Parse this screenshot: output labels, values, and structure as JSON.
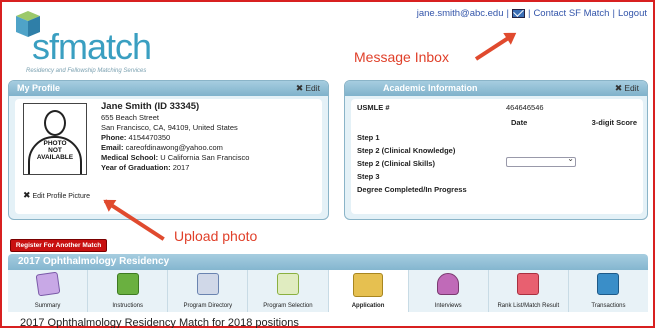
{
  "brand": {
    "logo_text": "sfmatch",
    "tagline": "Residency and Fellowship Matching Services"
  },
  "toplinks": {
    "email": "jane.smith@abc.edu",
    "contact": "Contact SF Match",
    "logout": "Logout"
  },
  "annotations": {
    "message_inbox": "Message Inbox",
    "upload_photo": "Upload photo"
  },
  "profile": {
    "title": "My Profile",
    "edit_label": "Edit",
    "photo_text": "PHOTO\nNOT\nAVAILABLE",
    "name": "Jane Smith (ID 33345)",
    "street": "655 Beach Street",
    "city": "San Francisco, CA, 94109, United States",
    "phone_label": "Phone:",
    "phone": "4154470350",
    "email_label": "Email:",
    "email": "careofdinawong@yahoo.com",
    "school_label": "Medical School:",
    "school": "U California San Francisco",
    "grad_label": "Year of Graduation:",
    "grad": "2017",
    "edit_picture": "Edit Profile Picture"
  },
  "academic": {
    "title": "Academic Information",
    "edit_label": "Edit",
    "usmle_label": "USMLE #",
    "usmle_value": "464646546",
    "col_date": "Date",
    "col_score": "3-digit Score",
    "step1": "Step 1",
    "step2ck": "Step 2 (Clinical Knowledge)",
    "step2cs": "Step 2 (Clinical Skills)",
    "step3": "Step 3",
    "degree": "Degree Completed/In Progress"
  },
  "register_button": "Register For Another Match",
  "residency_bar": "2017 Ophthalmology Residency",
  "tabs": [
    {
      "label": "Summary",
      "icon": "summary-icon"
    },
    {
      "label": "Instructions",
      "icon": "instructions-icon"
    },
    {
      "label": "Program Directory",
      "icon": "program-directory-icon"
    },
    {
      "label": "Program Selection",
      "icon": "program-selection-icon"
    },
    {
      "label": "Application",
      "icon": "folder-icon"
    },
    {
      "label": "Interviews",
      "icon": "interviews-icon"
    },
    {
      "label": "Rank List/Match Result",
      "icon": "rank-list-icon"
    },
    {
      "label": "Transactions",
      "icon": "transactions-icon"
    }
  ],
  "active_tab": "Application",
  "section_title": "2017 Ophthalmology Residency Match for 2018 positions"
}
